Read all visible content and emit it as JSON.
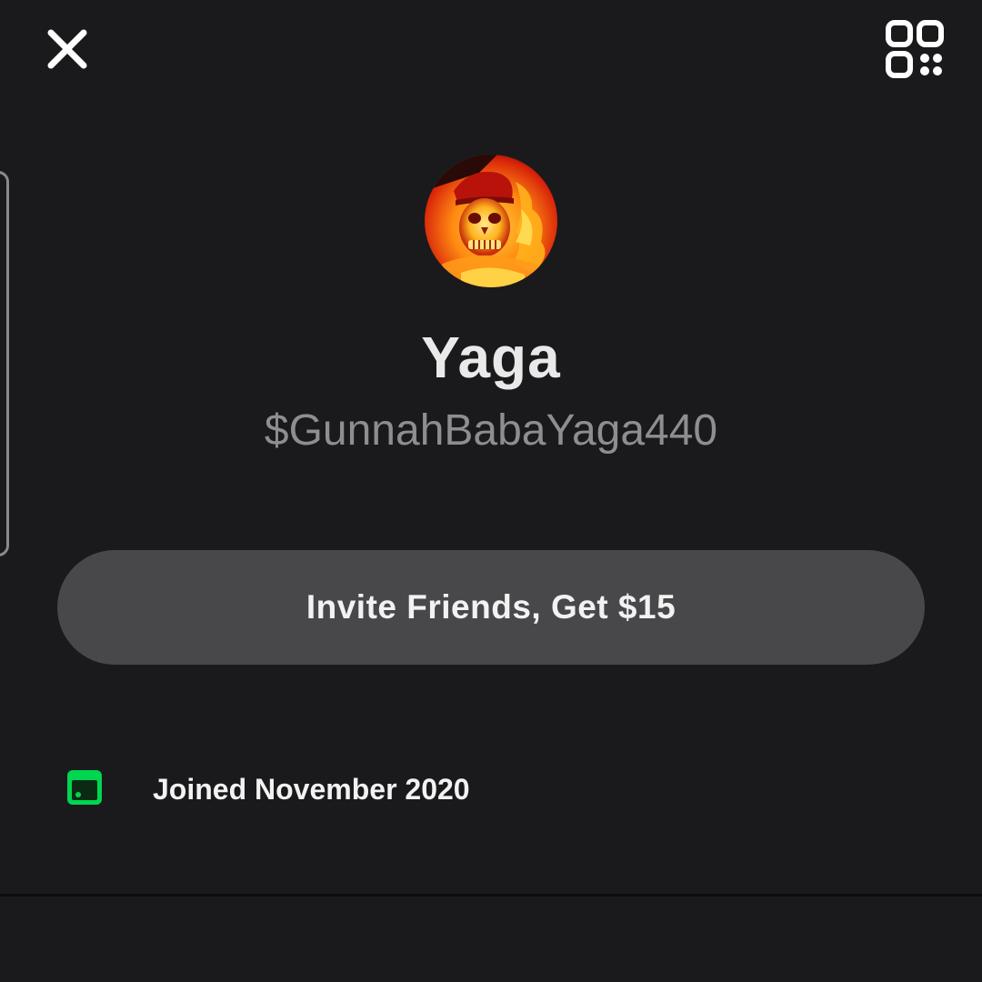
{
  "header": {
    "close_icon": "close-icon",
    "qr_icon": "qr-code-icon"
  },
  "profile": {
    "display_name": "Yaga",
    "cashtag": "$GunnahBabaYaga440",
    "avatar_alt": "profile avatar"
  },
  "actions": {
    "invite_label": "Invite Friends, Get $15"
  },
  "details": {
    "joined_text": "Joined November 2020",
    "joined_icon": "calendar-icon"
  },
  "colors": {
    "background": "#1a1a1c",
    "button_bg": "#48484a",
    "accent_green": "#00d64f",
    "text_primary": "#e9e9ea",
    "text_secondary": "#8e8e90"
  }
}
